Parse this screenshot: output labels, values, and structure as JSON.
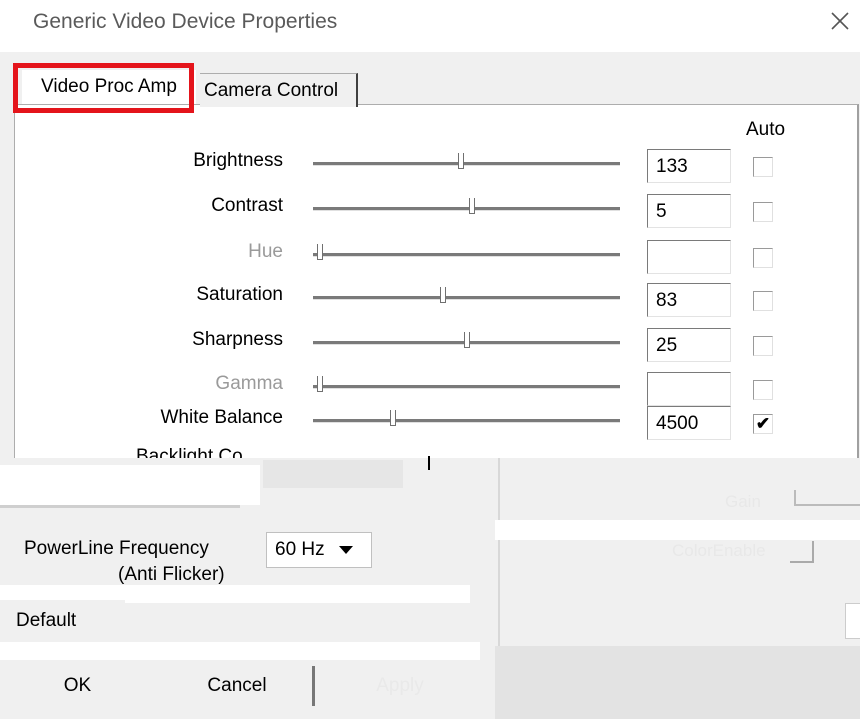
{
  "window": {
    "title": "Generic Video Device Properties"
  },
  "tabs": [
    {
      "label": "Video Proc Amp",
      "active": true
    },
    {
      "label": "Camera Control",
      "active": false
    }
  ],
  "auto_header": "Auto",
  "controls": [
    {
      "label": "Brightness",
      "value": "133",
      "enabled": true,
      "auto": false,
      "level": 0.48
    },
    {
      "label": "Contrast",
      "value": "5",
      "enabled": true,
      "auto": false,
      "level": 0.52
    },
    {
      "label": "Hue",
      "value": "",
      "enabled": false,
      "auto": false,
      "level": 0.0
    },
    {
      "label": "Saturation",
      "value": "83",
      "enabled": true,
      "auto": false,
      "level": 0.42
    },
    {
      "label": "Sharpness",
      "value": "25",
      "enabled": true,
      "auto": false,
      "level": 0.5
    },
    {
      "label": "Gamma",
      "value": "",
      "enabled": false,
      "auto": false,
      "level": 0.0
    },
    {
      "label": "White Balance",
      "value": "4500",
      "enabled": true,
      "auto": true,
      "level": 0.25
    }
  ],
  "partial": {
    "backlight_label": "Backlight Co"
  },
  "powerline": {
    "label_line1": "PowerLine Frequency",
    "label_line2": "(Anti Flicker)",
    "selected": "60 Hz"
  },
  "default_button": "Default",
  "buttons": {
    "ok": "OK",
    "cancel": "Cancel",
    "apply": "Apply"
  },
  "right_ghost": {
    "gain": "Gain",
    "color_enable": "ColorEnable"
  },
  "colors": {
    "highlight": "#e4141b",
    "dialog": "#f0f0f0"
  }
}
